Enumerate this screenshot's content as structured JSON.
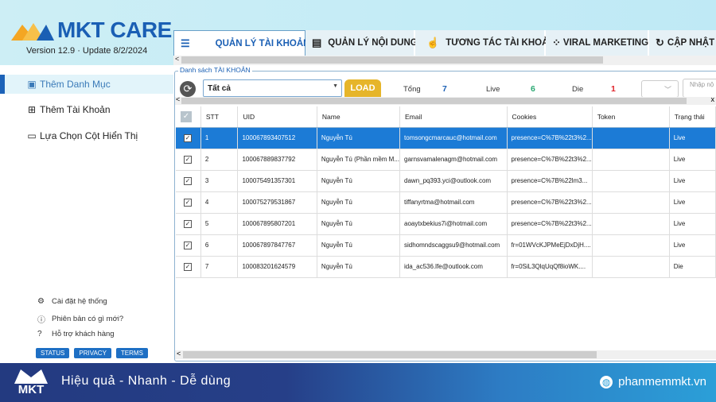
{
  "app": {
    "title": "MKT CARE",
    "version": "Version  12.9 · Update  8/2/2024"
  },
  "sidebar": {
    "items": [
      {
        "label": "Thêm Danh Mục",
        "icon": "category-icon",
        "active": true
      },
      {
        "label": "Thêm Tài Khoản",
        "icon": "add-box-icon"
      },
      {
        "label": "Lựa Chọn Cột Hiển Thị",
        "icon": "monitor-icon"
      }
    ],
    "bottom_links": [
      {
        "label": "Cài đặt hệ thống",
        "icon": "gear-icon"
      },
      {
        "label": "Phiên bản có gì mới?",
        "icon": "info-icon"
      },
      {
        "label": "Hỗ trợ khách hàng",
        "icon": "help-icon"
      }
    ],
    "buttons": [
      "STATUS",
      "PRIVACY",
      "TERMS"
    ]
  },
  "tabs": [
    {
      "label": "QUẢN LÝ TÀI KHOẢN",
      "icon": "list-search-icon",
      "active": true
    },
    {
      "label": "QUẢN LÝ NỘI DUNG",
      "icon": "document-icon"
    },
    {
      "label": "TƯƠNG TÁC TÀI KHOẢN",
      "icon": "hand-pointer-icon"
    },
    {
      "label": "VIRAL MARKETING",
      "icon": "nodes-icon"
    },
    {
      "label": "CẬP NHẬT",
      "icon": "update-icon"
    }
  ],
  "group_label": "Danh sách TÀI KHOẢN",
  "toolbar": {
    "filter_value": "Tất cả",
    "load_label": "LOAD",
    "total_label": "Tổng",
    "total": "7",
    "live_label": "Live",
    "live": "6",
    "die_label": "Die",
    "die": "1",
    "search_placeholder": "Nhập nộ",
    "close": "x"
  },
  "colors": {
    "accent": "#1a5fb4",
    "selected_row": "#1c7bd6",
    "live": "#2aa872",
    "die": "#e0242a",
    "load": "#e6b52a"
  },
  "table": {
    "columns": [
      "",
      "STT",
      "UID",
      "Name",
      "Email",
      "Cookies",
      "Token",
      "Trạng thái"
    ],
    "rows": [
      {
        "checked": true,
        "stt": "1",
        "uid": "100067893407512",
        "name": "Nguyễn Tú",
        "email": "tomsongcmarcauc@hotmail.com",
        "cookies": "presence=C%7B%22t3%2...",
        "token": "",
        "status": "Live",
        "selected": true
      },
      {
        "checked": true,
        "stt": "2",
        "uid": "100067889837792",
        "name": "Nguyễn Tú (Phần mềm M...",
        "email": "garnsvamalenagm@hotmail.com",
        "cookies": "presence=C%7B%22t3%2...",
        "token": "",
        "status": "Live"
      },
      {
        "checked": true,
        "stt": "3",
        "uid": "100075491357301",
        "name": "Nguyễn Tú",
        "email": "dawn_pq393.yci@outlook.com",
        "cookies": "presence=C%7B%22lm3...",
        "token": "",
        "status": "Live"
      },
      {
        "checked": true,
        "stt": "4",
        "uid": "100075279531867",
        "name": "Nguyễn Tú",
        "email": "tiffanyrtma@hotmail.com",
        "cookies": "presence=C%7B%22t3%2...",
        "token": "",
        "status": "Live"
      },
      {
        "checked": true,
        "stt": "5",
        "uid": "100067895807201",
        "name": "Nguyễn Tú",
        "email": "aoaytxbekius7i@hotmail.com",
        "cookies": "presence=C%7B%22t3%2...",
        "token": "",
        "status": "Live"
      },
      {
        "checked": true,
        "stt": "6",
        "uid": "100067897847767",
        "name": "Nguyễn Tú",
        "email": "sidhomndscaggsu9@hotmail.com",
        "cookies": "fr=01WVcKJPMeEjDxDjH....",
        "token": "",
        "status": "Live"
      },
      {
        "checked": true,
        "stt": "7",
        "uid": "100083201624579",
        "name": "Nguyễn Tú",
        "email": "ida_ac536.lfe@outlook.com",
        "cookies": "fr=0SiL3QlqUqQf8ioWK....",
        "token": "",
        "status": "Die"
      }
    ]
  },
  "footer": {
    "logo": "MKT",
    "slogan": "Hiệu quả - Nhanh  - Dễ dùng",
    "site": "phanmemmkt.vn"
  }
}
